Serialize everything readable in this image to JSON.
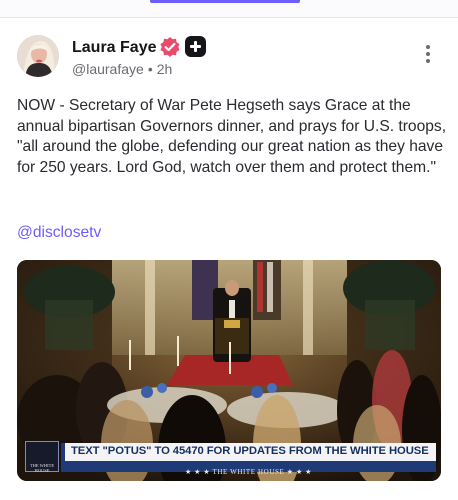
{
  "post": {
    "author": {
      "name": "Laura Faye",
      "handle": "@laurafaye",
      "separator": "•",
      "time": "2h"
    },
    "text": "NOW - Secretary of War Pete Hegseth says Grace at the annual bipartisan Governors dinner, and prays for U.S. troops, \"all around the globe, defending our great nation as they have for 250 years. Lord God, watch over them and protect them.\"",
    "mention": "@disclosetv",
    "media": {
      "banner_text": "TEXT \"POTUS\" TO 45470 FOR UPDATES FROM THE WHITE HOUSE",
      "banner_subtext": "★ ★ ★  THE WHITE HOUSE  ★ ★ ★"
    }
  },
  "icons": {
    "verified": "verified-badge-icon",
    "plus": "plus-badge-icon",
    "more": "more-vertical-icon"
  },
  "colors": {
    "accent": "#6d5dfc",
    "verified": "#e94b6a",
    "banner_blue": "#1e3b78"
  }
}
